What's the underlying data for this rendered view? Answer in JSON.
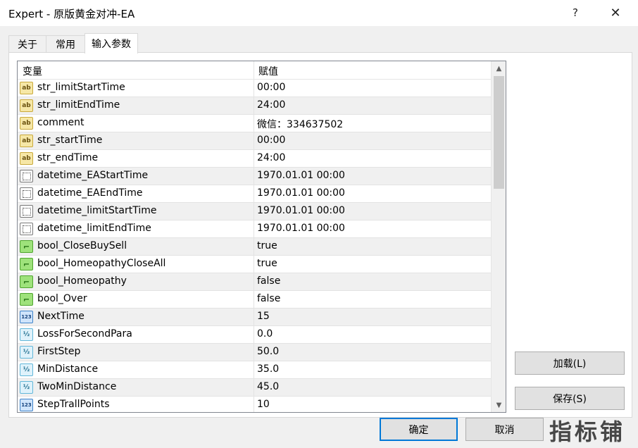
{
  "window": {
    "title": "Expert - 原版黄金对冲-EA",
    "help_glyph": "?",
    "close_glyph": "✕"
  },
  "tabs": [
    {
      "label": "关于"
    },
    {
      "label": "常用"
    },
    {
      "label": "输入参数"
    }
  ],
  "table": {
    "col_variable": "变量",
    "col_value": "赋值",
    "rows": [
      {
        "icon": "ab",
        "name": "str_limitStartTime",
        "value": "00:00"
      },
      {
        "icon": "ab",
        "name": "str_limitEndTime",
        "value": "24:00"
      },
      {
        "icon": "ab",
        "name": "comment",
        "value": "微信：334637502"
      },
      {
        "icon": "ab",
        "name": "str_startTime",
        "value": "00:00"
      },
      {
        "icon": "ab",
        "name": "str_endTime",
        "value": "24:00"
      },
      {
        "icon": "datetime",
        "name": "datetime_EAStartTime",
        "value": "1970.01.01 00:00"
      },
      {
        "icon": "datetime",
        "name": "datetime_EAEndTime",
        "value": "1970.01.01 00:00"
      },
      {
        "icon": "datetime",
        "name": "datetime_limitStartTime",
        "value": "1970.01.01 00:00"
      },
      {
        "icon": "datetime",
        "name": "datetime_limitEndTime",
        "value": "1970.01.01 00:00"
      },
      {
        "icon": "bool",
        "name": "bool_CloseBuySell",
        "value": "true"
      },
      {
        "icon": "bool",
        "name": "bool_HomeopathyCloseAll",
        "value": "true"
      },
      {
        "icon": "bool",
        "name": "bool_Homeopathy",
        "value": "false"
      },
      {
        "icon": "bool",
        "name": "bool_Over",
        "value": "false"
      },
      {
        "icon": "123",
        "name": "NextTime",
        "value": "15"
      },
      {
        "icon": "1/2",
        "name": "LossForSecondPara",
        "value": "0.0"
      },
      {
        "icon": "1/2",
        "name": "FirstStep",
        "value": "50.0"
      },
      {
        "icon": "1/2",
        "name": "MinDistance",
        "value": "35.0"
      },
      {
        "icon": "1/2",
        "name": "TwoMinDistance",
        "value": "45.0"
      },
      {
        "icon": "123",
        "name": "StepTrallPoints",
        "value": "10"
      }
    ]
  },
  "buttons": {
    "load": "加载(L)",
    "save": "保存(S)",
    "ok": "确定",
    "cancel": "取消"
  },
  "watermark": "指标铺"
}
